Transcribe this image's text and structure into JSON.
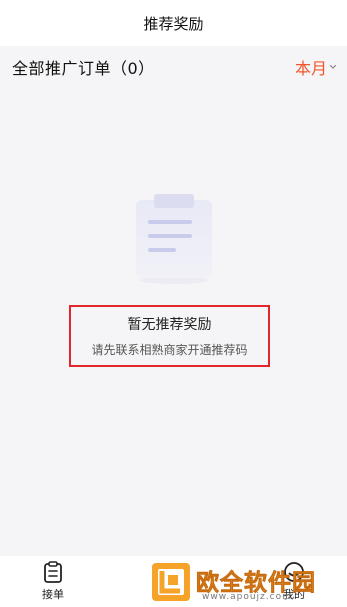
{
  "header": {
    "title": "推荐奖励"
  },
  "filter": {
    "title": "全部推广订单（0）",
    "period": "本月"
  },
  "empty_state": {
    "title": "暂无推荐奖励",
    "subtitle": "请先联系相熟商家开通推荐码"
  },
  "tabbar": {
    "items": [
      {
        "label": "接单",
        "icon": "clipboard-icon"
      },
      {
        "label": "我的",
        "icon": "profile-icon"
      }
    ]
  },
  "watermark": {
    "title": "欧全软件园",
    "url": "www.apoujz.com"
  },
  "colors": {
    "accent": "#f2572b",
    "highlight_border": "#e3262b",
    "background": "#f5f5f7"
  }
}
